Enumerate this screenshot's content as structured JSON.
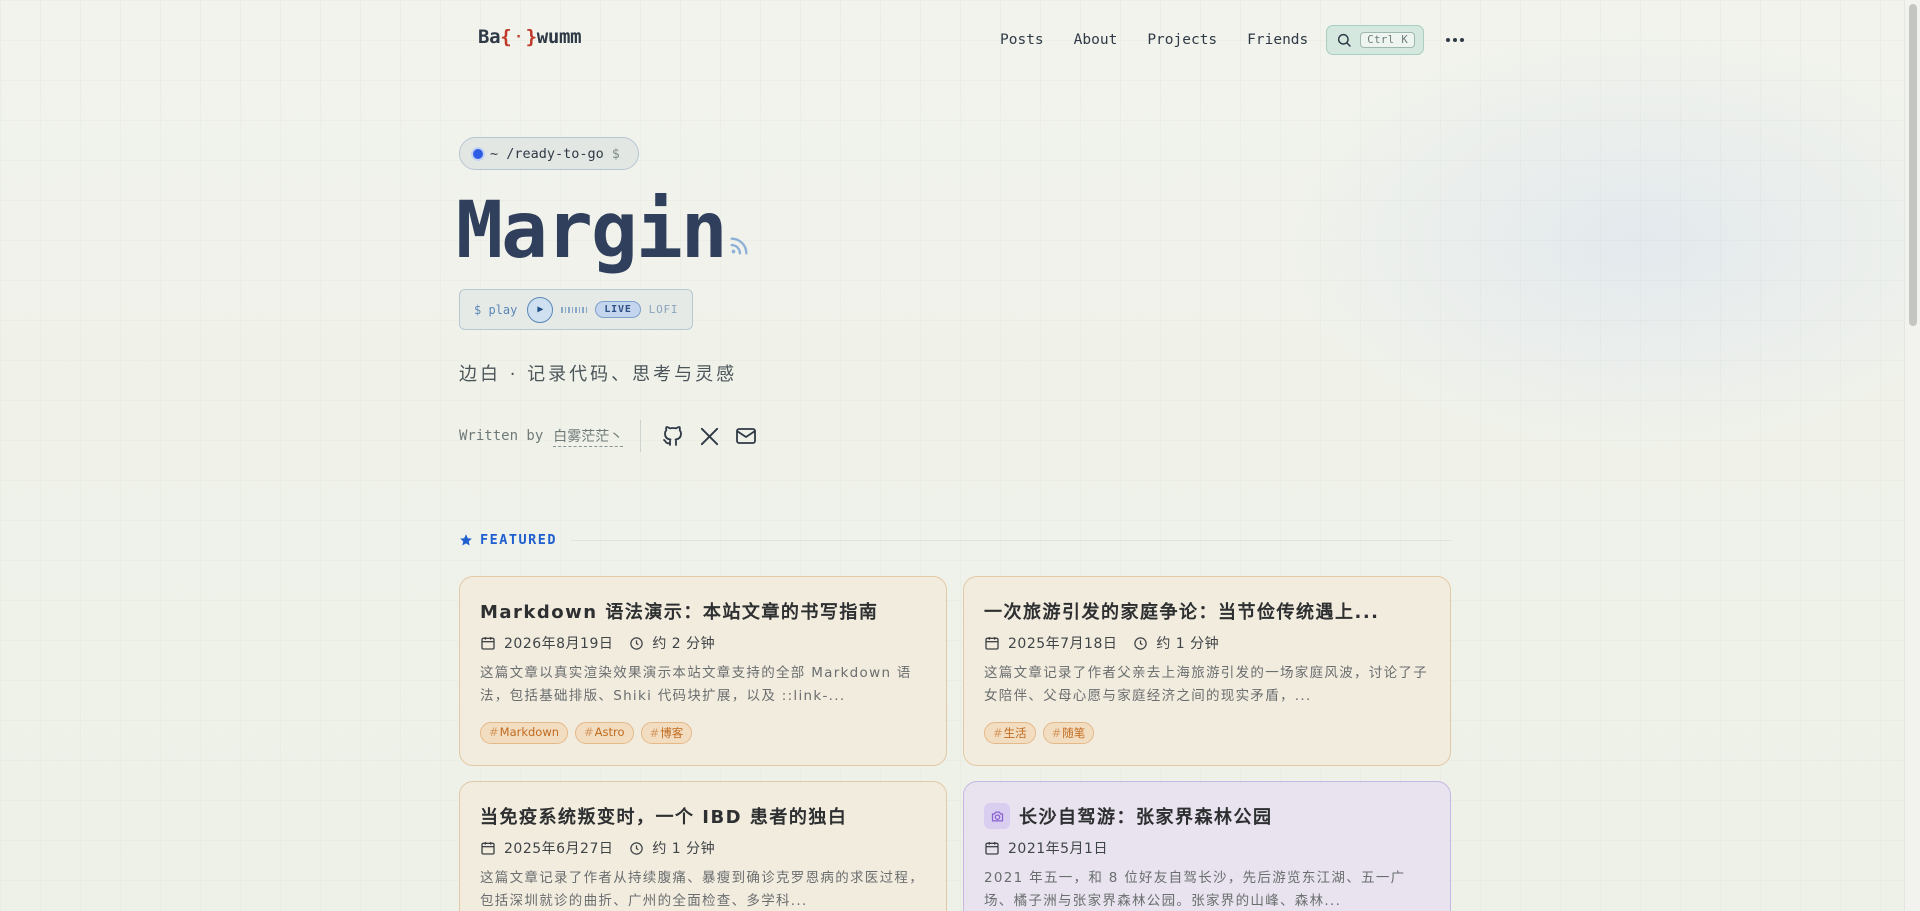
{
  "header": {
    "logo": {
      "prefix": "Ba",
      "brace_open": "{",
      "dot": "·",
      "brace_close": "}",
      "suffix": "wumm"
    },
    "nav": [
      "Posts",
      "About",
      "Projects",
      "Friends"
    ],
    "search_shortcut": "Ctrl K"
  },
  "hero": {
    "path": "~ /ready-to-go",
    "prompt": "$",
    "title": "Margin",
    "player": {
      "command": "$ play",
      "play_glyph": "▶",
      "status": "LIVE",
      "genre": "LOFI"
    },
    "subtitle": "边白 · 记录代码、思考与灵感",
    "written_by": "Written by",
    "author": "白雾茫茫丶"
  },
  "social_icons": [
    "github-icon",
    "x-icon",
    "mail-icon"
  ],
  "featured": {
    "label": "FEATURED",
    "posts": [
      {
        "title": "Markdown 语法演示：本站文章的书写指南",
        "date": "2026年8月19日",
        "read_time": "约 2 分钟",
        "excerpt": "这篇文章以真实渲染效果演示本站文章支持的全部 Markdown 语法，包括基础排版、Shiki 代码块扩展，以及 ::link-...",
        "tags": [
          "Markdown",
          "Astro",
          "博客"
        ]
      },
      {
        "title": "一次旅游引发的家庭争论：当节俭传统遇上...",
        "date": "2025年7月18日",
        "read_time": "约 1 分钟",
        "excerpt": "这篇文章记录了作者父亲去上海旅游引发的一场家庭风波，讨论了子女陪伴、父母心愿与家庭经济之间的现实矛盾，...",
        "tags": [
          "生活",
          "随笔"
        ]
      },
      {
        "title": "当免疫系统叛变时，一个 IBD 患者的独白",
        "date": "2025年6月27日",
        "read_time": "约 1 分钟",
        "excerpt": "这篇文章记录了作者从持续腹痛、暴瘦到确诊克罗恩病的求医过程，包括深圳就诊的曲折、广州的全面检查、多学科...",
        "tags": []
      },
      {
        "title": "长沙自驾游：张家界森林公园",
        "date": "2021年5月1日",
        "read_time": "",
        "excerpt": "2021 年五一，和 8 位好友自驾长沙，先后游览东江湖、五一广场、橘子洲与张家界森林公园。张家界的山峰、森林...",
        "tags": []
      }
    ]
  },
  "colors": {
    "accent_blue": "#1f5fcf",
    "title": "#2f3f5c",
    "tag_orange": "#c06a1f",
    "photo_card_purple": "#c7b7e3"
  }
}
